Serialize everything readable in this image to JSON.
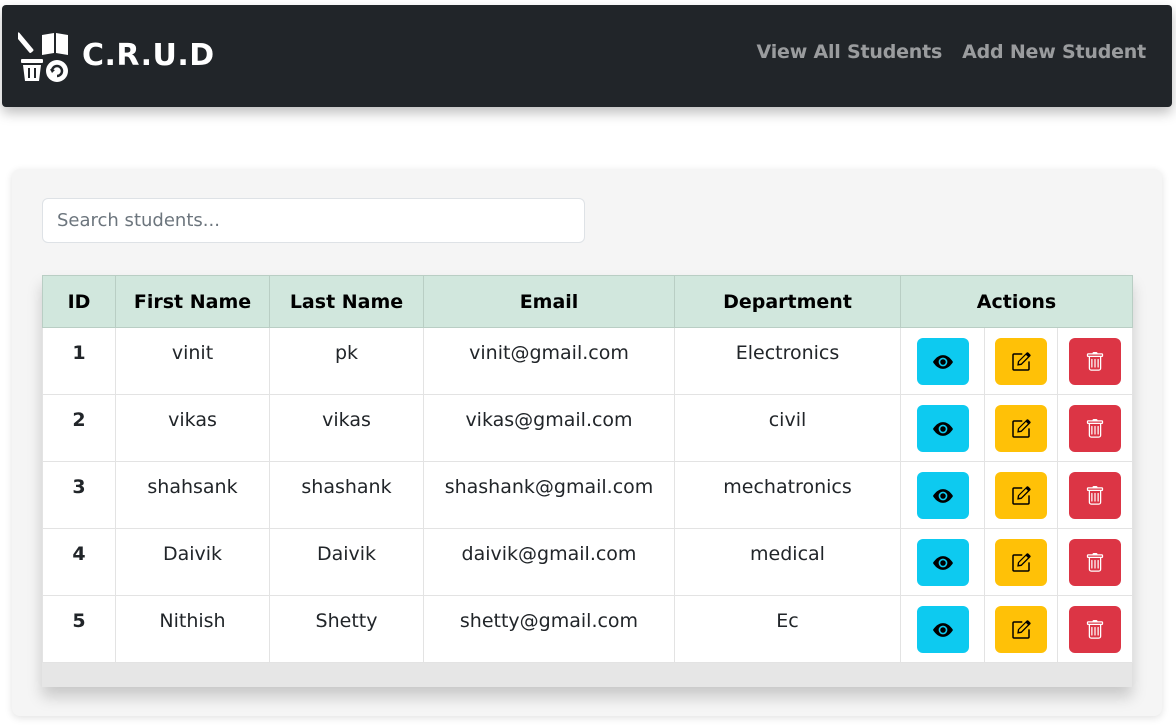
{
  "navbar": {
    "brand": "C.R.U.D",
    "links": [
      "View All Students",
      "Add New Student"
    ]
  },
  "search": {
    "placeholder": "Search students...",
    "value": ""
  },
  "table": {
    "headers": [
      "ID",
      "First Name",
      "Last Name",
      "Email",
      "Department",
      "Actions"
    ],
    "rows": [
      {
        "id": "1",
        "first": "vinit",
        "last": "pk",
        "email": "vinit@gmail.com",
        "dept": "Electronics"
      },
      {
        "id": "2",
        "first": "vikas",
        "last": "vikas",
        "email": "vikas@gmail.com",
        "dept": "civil"
      },
      {
        "id": "3",
        "first": "shahsank",
        "last": "shashank",
        "email": "shashank@gmail.com",
        "dept": "mechatronics"
      },
      {
        "id": "4",
        "first": "Daivik",
        "last": "Daivik",
        "email": "daivik@gmail.com",
        "dept": "medical"
      },
      {
        "id": "5",
        "first": "Nithish",
        "last": "Shetty",
        "email": "shetty@gmail.com",
        "dept": "Ec"
      }
    ]
  },
  "icons": {
    "logo": "crud-logo-icon",
    "view": "eye-icon",
    "edit": "pencil-square-icon",
    "delete": "trash-icon"
  },
  "colors": {
    "navbar": "#212529",
    "header_row": "#d1e7dd",
    "view_button": "#0dcaf0",
    "edit_button": "#ffc107",
    "delete_button": "#dc3545"
  }
}
